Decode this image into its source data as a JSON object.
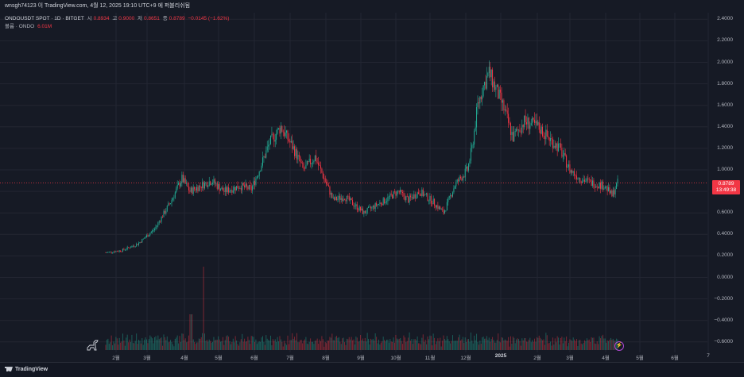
{
  "topbar": {
    "caption": "wnsgh74123 이 TradingView.com, 4월 12, 2025 19:10 UTC+9 에 퍼블리쉬됨"
  },
  "legend": {
    "symbol": "ONDOUSDT SPOT · 1D · BITGET",
    "open_label": "시",
    "open": "0.8934",
    "high_label": "고",
    "high": "0.9000",
    "low_label": "저",
    "low": "0.8651",
    "close_label": "종",
    "close": "0.8789",
    "change": "−0.0145 (−1.62%)",
    "volume_label": "볼륨 · ONDO",
    "volume": "6.01M"
  },
  "price_tag": {
    "price": "0.8789",
    "countdown": "13:49:38"
  },
  "axis": {
    "y_ticks": [
      "2.4000",
      "2.2000",
      "2.0000",
      "1.8000",
      "1.6000",
      "1.4000",
      "1.2000",
      "1.0000",
      "0.8000",
      "0.6000",
      "0.4000",
      "0.2000",
      "0.0000",
      "−0.2000",
      "−0.4000",
      "−0.6000"
    ],
    "x_ticks": [
      "2월",
      "3월",
      "4월",
      "5월",
      "6월",
      "7월",
      "8월",
      "9월",
      "10월",
      "11월",
      "12월",
      "2025",
      "2월",
      "3월",
      "4월",
      "5월",
      "6월",
      "7"
    ]
  },
  "colors": {
    "up": "#22ab94",
    "down": "#f23645",
    "bg": "#161a25",
    "grid": "#232632"
  },
  "footer": {
    "brand": "TradingView"
  },
  "chart_data": {
    "type": "candlestick",
    "symbol": "ONDOUSDT",
    "ylim": [
      -0.65,
      2.45
    ],
    "x": [
      "2024-01-18",
      "2024-02-01",
      "2024-02-15",
      "2024-03-01",
      "2024-03-15",
      "2024-03-25",
      "2024-04-01",
      "2024-04-10",
      "2024-04-20",
      "2024-05-01",
      "2024-05-15",
      "2024-05-25",
      "2024-06-01",
      "2024-06-10",
      "2024-06-20",
      "2024-07-01",
      "2024-07-10",
      "2024-07-20",
      "2024-08-01",
      "2024-08-05",
      "2024-08-15",
      "2024-09-01",
      "2024-09-10",
      "2024-09-20",
      "2024-10-01",
      "2024-10-10",
      "2024-10-20",
      "2024-11-01",
      "2024-11-10",
      "2024-11-20",
      "2024-12-01",
      "2024-12-05",
      "2024-12-10",
      "2024-12-15",
      "2024-12-20",
      "2025-01-01",
      "2025-01-10",
      "2025-01-20",
      "2025-02-01",
      "2025-02-10",
      "2025-02-20",
      "2025-03-01",
      "2025-03-10",
      "2025-03-20",
      "2025-04-01",
      "2025-04-07",
      "2025-04-12"
    ],
    "close": [
      0.23,
      0.25,
      0.31,
      0.45,
      0.7,
      0.92,
      0.8,
      0.85,
      0.9,
      0.8,
      0.85,
      0.82,
      1.0,
      1.25,
      1.4,
      1.2,
      1.0,
      1.12,
      0.82,
      0.72,
      0.75,
      0.6,
      0.66,
      0.72,
      0.8,
      0.72,
      0.8,
      0.7,
      0.6,
      0.86,
      1.0,
      1.2,
      1.6,
      1.78,
      1.9,
      1.6,
      1.3,
      1.45,
      1.4,
      1.3,
      1.2,
      1.0,
      0.92,
      0.88,
      0.85,
      0.76,
      0.8789
    ]
  }
}
